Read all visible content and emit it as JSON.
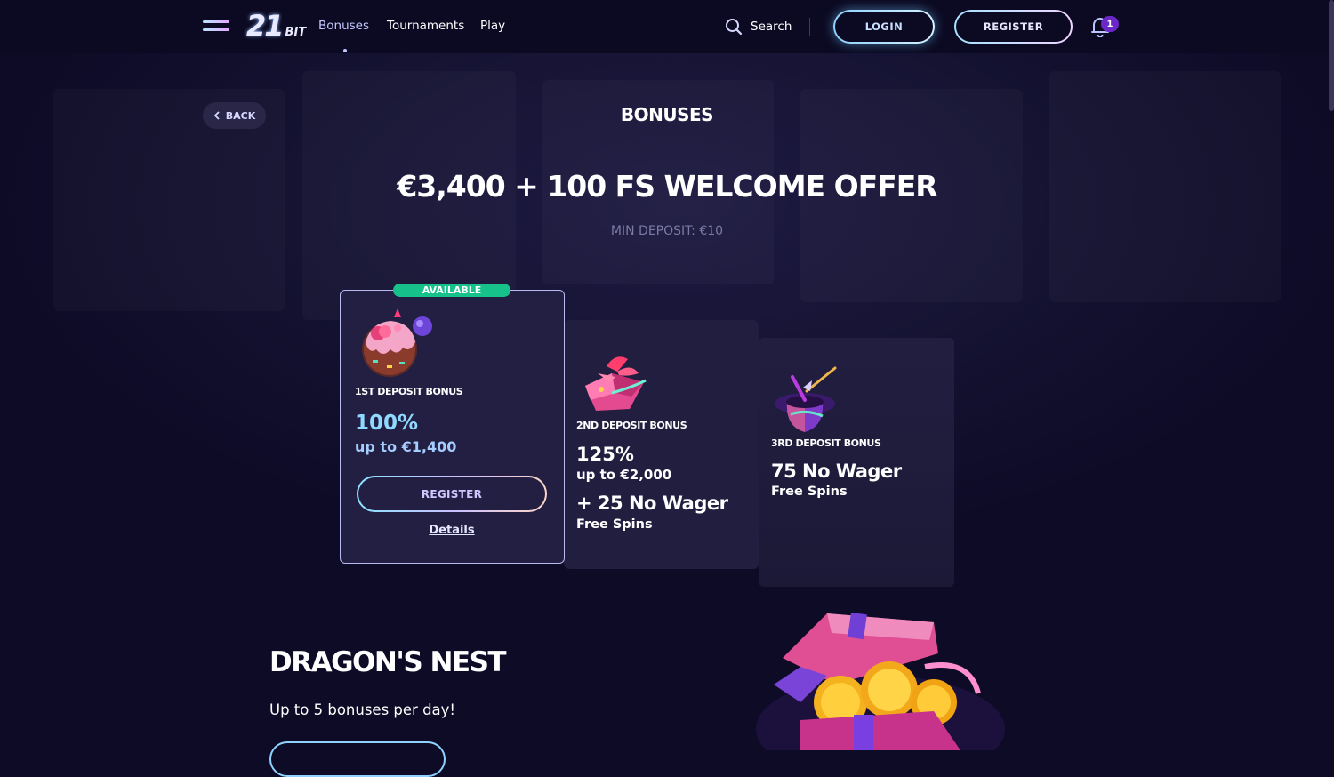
{
  "header": {
    "logo_number": "21",
    "logo_suffix": "BIT",
    "nav": {
      "bonuses": "Bonuses",
      "tournaments": "Tournaments",
      "play": "Play"
    },
    "search_label": "Search",
    "login_label": "LOGIN",
    "register_label": "REGISTER",
    "notification_count": "1"
  },
  "page": {
    "back_label": "BACK",
    "title": "BONUSES",
    "offer_title": "€3,400 + 100 FS WELCOME OFFER",
    "min_deposit": "MIN DEPOSIT: €10"
  },
  "cards": [
    {
      "badge": "AVAILABLE",
      "title": "1ST DEPOSIT BONUS",
      "percent": "100%",
      "upto": "up to €1,400",
      "button": "REGISTER",
      "details": "Details",
      "icon": "donut-icon"
    },
    {
      "title": "2ND DEPOSIT BONUS",
      "percent": "125%",
      "upto": "up to €2,000",
      "extra_big": "+ 25 No Wager",
      "extra_small": "Free Spins",
      "icon": "gift-icon"
    },
    {
      "title": "3RD DEPOSIT BONUS",
      "big": "75 No Wager",
      "small": "Free Spins",
      "icon": "magic-hat-icon"
    }
  ],
  "dragon": {
    "title": "DRAGON'S NEST",
    "subtitle": "Up to 5 bonuses per day!",
    "icon": "treasure-chest-icon"
  },
  "colors": {
    "background": "#0d0b26",
    "card": "#231f42",
    "available_green": "#16c28a",
    "accent_lilac": "#c4c7ff",
    "percent_cyan": "#8fd8ff",
    "notification_purple": "#6c27c9"
  }
}
